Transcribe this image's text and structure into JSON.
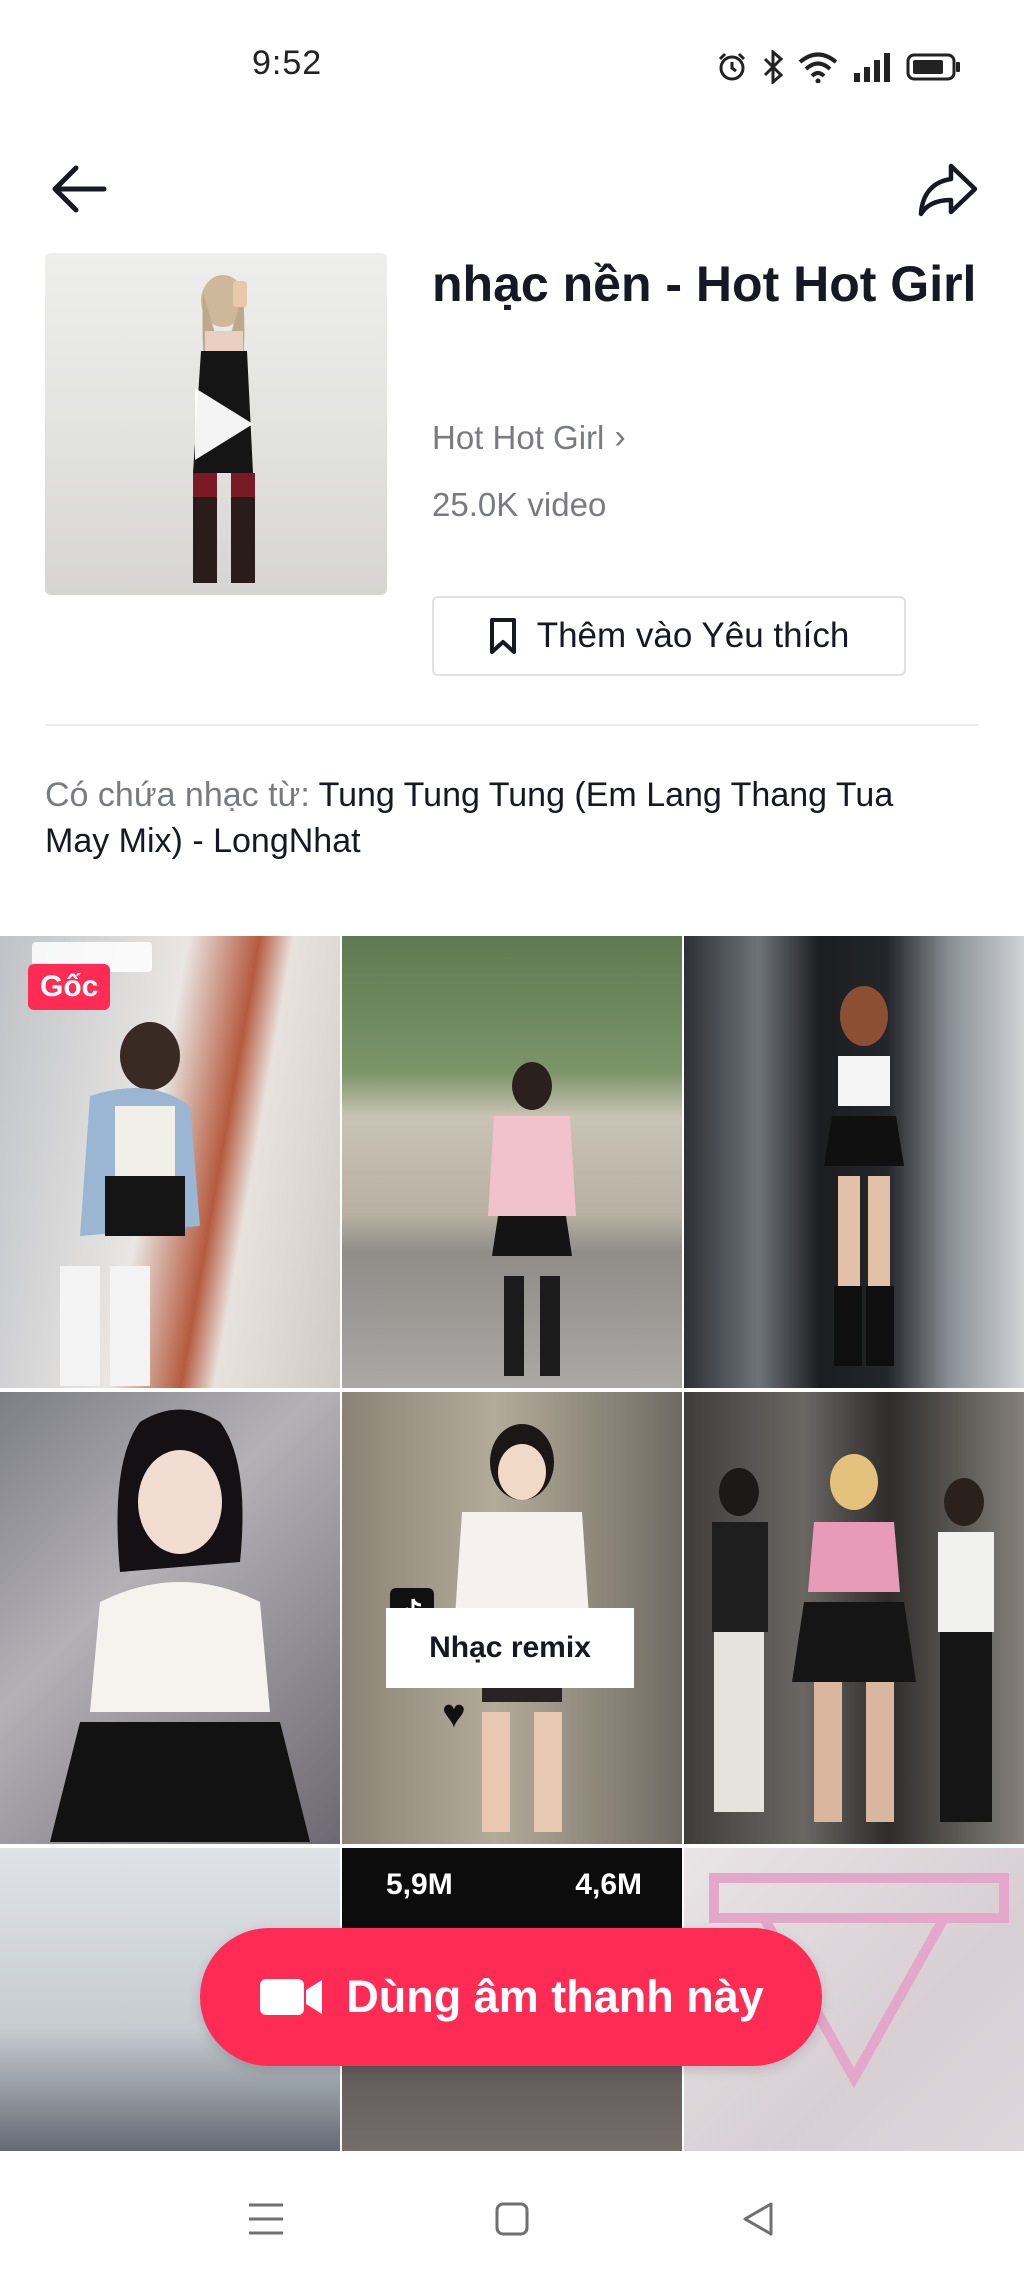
{
  "status_bar": {
    "time": "9:52",
    "icons": [
      "alarm-icon",
      "bluetooth-icon",
      "wifi-icon",
      "signal-icon",
      "battery-icon"
    ]
  },
  "header": {
    "back_icon": "arrow-left-icon",
    "share_icon": "share-arrow-icon"
  },
  "sound": {
    "title": "nhạc nền - Hot Hot Girl",
    "author": "Hot Hot Girl",
    "author_chevron": "›",
    "video_count": "25.0K video",
    "favorite_label": "Thêm vào Yêu thích",
    "favorite_icon": "bookmark-icon",
    "contains_label": "Có chứa nhạc từ:",
    "contains_value": "Tung Tung Tung (Em Lang Thang Tua May Mix) - LongNhat"
  },
  "videos": {
    "original_badge": "Gốc",
    "remix_caption": "Nhạc remix",
    "stats_left": "5,9M",
    "stats_right": "4,6M"
  },
  "cta": {
    "label": "Dùng âm thanh này",
    "icon": "video-camera-icon"
  },
  "nav": {
    "items": [
      "menu-icon",
      "home-square-icon",
      "back-triangle-icon"
    ]
  },
  "colors": {
    "accent": "#fe2c55",
    "text_primary": "#161823",
    "text_secondary": "#7a7b82"
  }
}
